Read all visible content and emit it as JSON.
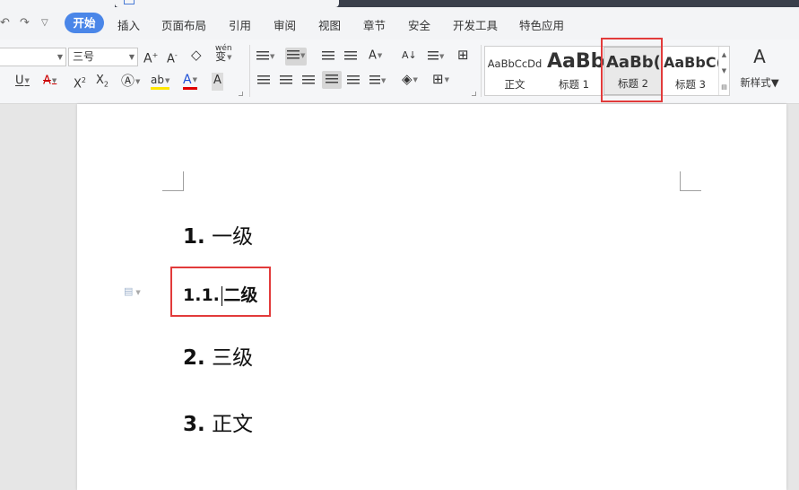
{
  "menu": {
    "items": [
      "开始",
      "插入",
      "页面布局",
      "引用",
      "审阅",
      "视图",
      "章节",
      "安全",
      "开发工具",
      "特色应用"
    ],
    "active": "开始"
  },
  "ribbon": {
    "font_size_value": "三号",
    "wen_label": "wén",
    "wen_char": "变",
    "new_style_label": "新样式",
    "new_style_icon": "A"
  },
  "styles": [
    {
      "preview": "AaBbCcDd",
      "label": "正文"
    },
    {
      "preview": "AaBb",
      "label": "标题 1"
    },
    {
      "preview": "AaBb(",
      "label": "标题 2"
    },
    {
      "preview": "AaBbC(",
      "label": "标题 3"
    }
  ],
  "document": {
    "lines": [
      {
        "num": "1.",
        "text": "一级"
      },
      {
        "num": "1.1.",
        "text": "二级"
      },
      {
        "num": "2.",
        "text": "三级"
      },
      {
        "num": "3.",
        "text": "正文"
      }
    ]
  },
  "colors": {
    "accent": "#4a86e8",
    "highlight_box": "#e23b3b",
    "font_color_bar": "#e00000",
    "highlight_bar": "#ffe600"
  }
}
